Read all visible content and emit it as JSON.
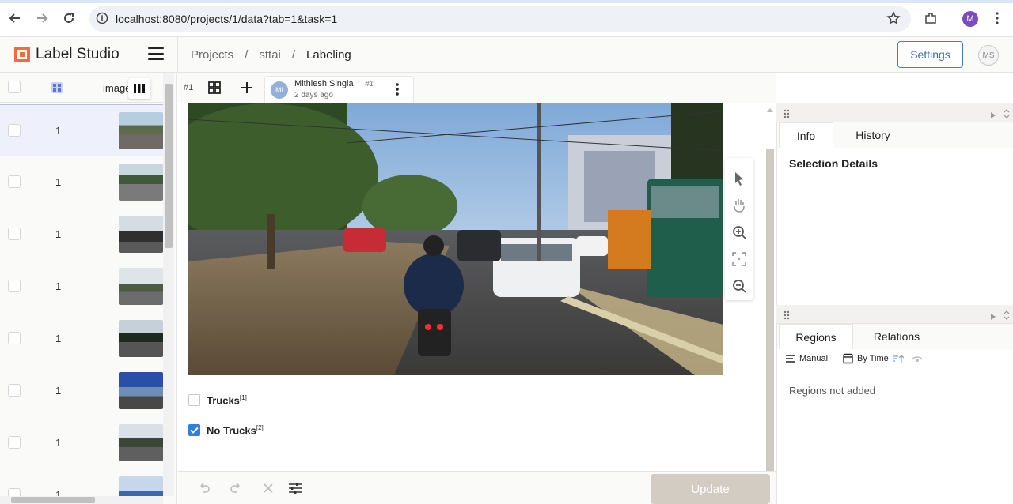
{
  "browser": {
    "url": "localhost:8080/projects/1/data?tab=1&task=1",
    "profile_initial": "M"
  },
  "app": {
    "logo_text": "Label Studio",
    "breadcrumb": [
      "Projects",
      "sttai",
      "Labeling"
    ],
    "settings_label": "Settings",
    "user_initials": "MS"
  },
  "task_list": {
    "column_header": "image",
    "rows": [
      {
        "id": "1"
      },
      {
        "id": "1"
      },
      {
        "id": "1"
      },
      {
        "id": "1"
      },
      {
        "id": "1"
      },
      {
        "id": "1"
      },
      {
        "id": "1"
      },
      {
        "id": "1"
      }
    ]
  },
  "annotation": {
    "id_label": "#1",
    "author": "Mithlesh Singla",
    "author_initials": "MI",
    "annotation_num": "#1",
    "time_ago": "2 days ago"
  },
  "choices": [
    {
      "label": "Trucks",
      "hotkey": "[1]",
      "checked": false
    },
    {
      "label": "No Trucks",
      "hotkey": "[2]",
      "checked": true
    }
  ],
  "bottom": {
    "update_label": "Update"
  },
  "side_panel": {
    "tabs_top": [
      "Info",
      "History"
    ],
    "selection_details": "Selection Details",
    "tabs_bottom": [
      "Regions",
      "Relations"
    ],
    "manual_label": "Manual",
    "by_time_label": "By Time",
    "regions_empty": "Regions not added"
  }
}
